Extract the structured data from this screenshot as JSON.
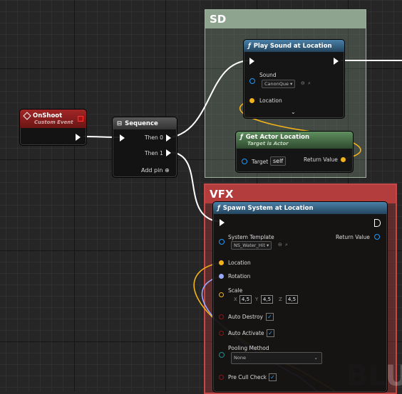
{
  "comments": {
    "sd": {
      "title": "SD",
      "color": "#8fa48f"
    },
    "vfx": {
      "title": "VFX",
      "color": "#b33c3c"
    },
    "watermark": "BLU"
  },
  "nodes": {
    "on_shoot": {
      "title": "OnShoot",
      "subtitle": "Custom Event",
      "icon": "event-diamond-icon",
      "header_color": "#8c1f1f"
    },
    "sequence": {
      "title": "Sequence",
      "then0": "Then 0",
      "then1": "Then 1",
      "add_pin": "Add pin",
      "icon": "sequence-icon",
      "header_color": "#4a4a4a"
    },
    "play_sound": {
      "title": "Play Sound at Location",
      "sound_label": "Sound",
      "sound_value": "CanonQue",
      "location_label": "Location",
      "icon": "function-icon",
      "header_color": "#3b6a8a"
    },
    "get_actor_location": {
      "title": "Get Actor Location",
      "subtitle": "Target is Actor",
      "target_label": "Target",
      "target_value": "self",
      "return_label": "Return Value",
      "icon": "function-icon",
      "header_color": "#4f7a4f"
    },
    "spawn_system": {
      "title": "Spawn System at Location",
      "template_label": "System Template",
      "template_value": "NS_Water_Hit",
      "return_label": "Return Value",
      "location_label": "Location",
      "rotation_label": "Rotation",
      "scale_label": "Scale",
      "scale_axes": [
        "X",
        "Y",
        "Z"
      ],
      "scale_values": [
        "4,5",
        "4,5",
        "4,5"
      ],
      "auto_destroy_label": "Auto Destroy",
      "auto_activate_label": "Auto Activate",
      "pooling_label": "Pooling Method",
      "pooling_value": "None",
      "pre_cull_label": "Pre Cull Check",
      "icon": "function-icon",
      "header_color": "#3b6a8a"
    }
  },
  "colors": {
    "exec": "#ffffff",
    "object": "#1a9bff",
    "vector": "#f2b31a",
    "rotator": "#9aa7ff",
    "bool": "#8c1515"
  }
}
